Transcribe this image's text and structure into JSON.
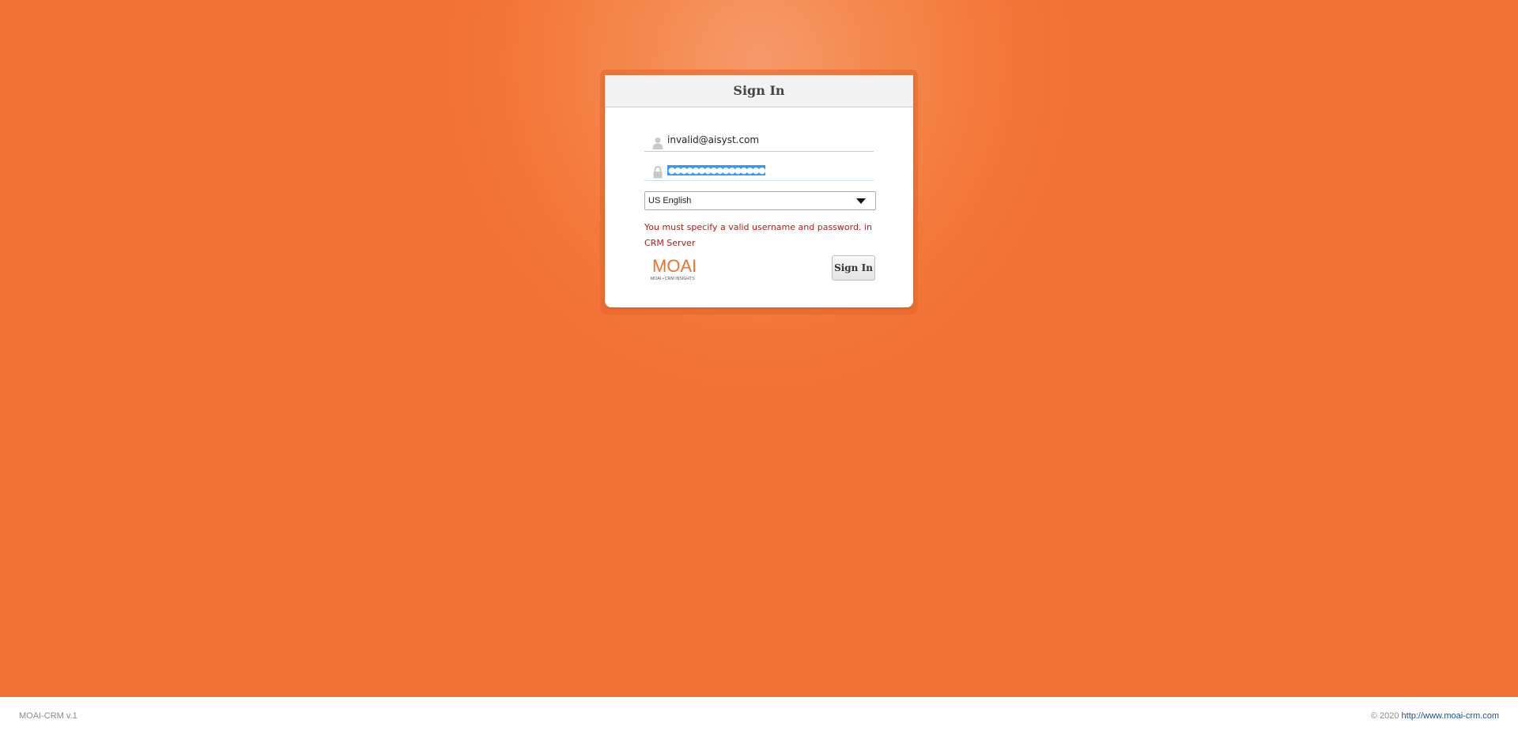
{
  "login": {
    "title": "Sign In",
    "username_value": "invalid@aisyst.com",
    "password_masked": "●●●●●●●●●●●●●●●●",
    "language_selected": "US English",
    "error_message": "You must specify a valid username and password. in CRM Server",
    "submit_label": "Sign In"
  },
  "logo": {
    "name": "MOAI",
    "tagline": "MOAI • CRM INSIGHTS"
  },
  "footer": {
    "version": "MOAI-CRM v.1",
    "copyright": "© 2020",
    "link_text": "http://www.moai-crm.com"
  },
  "colors": {
    "background": "#f37a3c",
    "error": "#b31b1b",
    "selection": "#3297fd",
    "link": "#1a4f8b"
  },
  "icons": {
    "username": "user-icon",
    "password": "lock-icon",
    "dropdown": "chevron-down-icon"
  }
}
